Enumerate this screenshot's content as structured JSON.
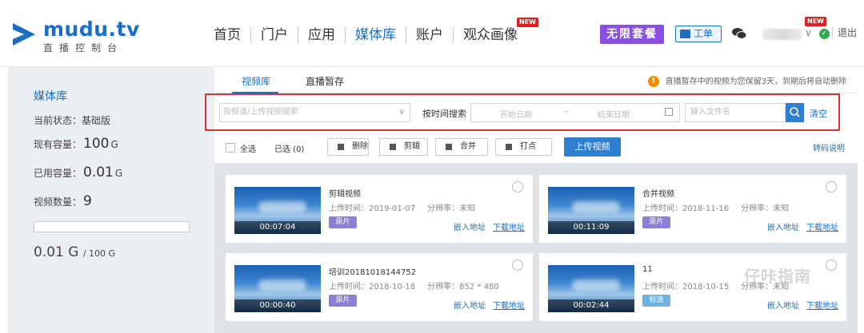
{
  "brand": {
    "name": "mudu.tv",
    "tagline": "直播控制台",
    "color": "#1b6ec2"
  },
  "nav": {
    "items": [
      {
        "label": "首页"
      },
      {
        "label": "门户"
      },
      {
        "label": "应用"
      },
      {
        "label": "媒体库",
        "active": true
      },
      {
        "label": "账户"
      },
      {
        "label": "观众画像",
        "badge": "NEW"
      }
    ]
  },
  "header": {
    "unlimited_label": "无限套餐",
    "ticket_label": "工单",
    "user_badge": "NEW",
    "logout_label": "退出"
  },
  "sidebar": {
    "title": "媒体库",
    "status_label": "当前状态：",
    "status_value": "基础版",
    "capacity_label": "现有容量：",
    "capacity_value": "100",
    "capacity_unit": "G",
    "used_label": "已用容量：",
    "used_value": "0.01",
    "used_unit": "G",
    "count_label": "视频数量：",
    "count_value": "9",
    "usage_fraction": 0.0001,
    "total_used": "0.01 G",
    "total_cap": "/ 100 G"
  },
  "tabs": {
    "items": [
      {
        "label": "视频库",
        "active": true
      },
      {
        "label": "直播暂存"
      }
    ],
    "notice": "直播暂存中的视频为您保留3天，到期后将自动删除"
  },
  "search": {
    "select_placeholder": "按频道/上传视频搜索",
    "time_label": "按时间搜索",
    "start_placeholder": "开始日期",
    "range_sep": "~",
    "end_placeholder": "结束日期",
    "file_placeholder": "输入文件名",
    "clear_label": "清空"
  },
  "toolbar": {
    "select_all": "全选",
    "selected": "已选 (0)",
    "delete": "删除",
    "clip": "剪辑",
    "merge": "合并",
    "mark": "打点",
    "upload": "上传视频",
    "code_help": "转码说明"
  },
  "videos": [
    {
      "name": "剪辑视频",
      "upload_label": "上传时间：",
      "date": "2019-01-07",
      "res_label": "分辨率：",
      "res": "未知",
      "duration": "00:07:04",
      "tag": "原片",
      "tag_color": "#8c7fd6",
      "embed": "嵌入地址",
      "download": "下载地址"
    },
    {
      "name": "合并视频",
      "upload_label": "上传时间：",
      "date": "2018-11-16",
      "res_label": "分辨率：",
      "res": "未知",
      "duration": "00:11:09",
      "tag": "原片",
      "tag_color": "#8c7fd6",
      "embed": "嵌入地址",
      "download": "下载地址"
    },
    {
      "name": "培训20181018144752",
      "upload_label": "上传时间：",
      "date": "2018-10-18",
      "res_label": "分辨率：",
      "res": "852 * 480",
      "duration": "00:00:40",
      "tag": "原片",
      "tag_color": "#8c7fd6",
      "embed": "嵌入地址",
      "download": "下载地址"
    },
    {
      "name": "11",
      "upload_label": "上传时间：",
      "date": "2018-10-15",
      "res_label": "分辨率：",
      "res": "未知",
      "duration": "00:02:44",
      "tag": "标清",
      "tag_color": "#6fb4e0",
      "embed": "嵌入地址",
      "download": "下载地址"
    }
  ],
  "watermark": "仔咔指南"
}
